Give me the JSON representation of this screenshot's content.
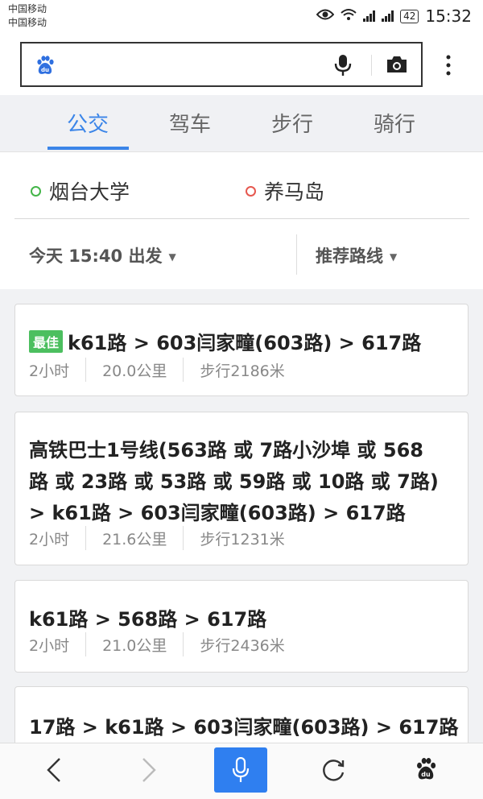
{
  "status_bar": {
    "carrier_1": "中国移动",
    "carrier_2": "中国移动",
    "battery": "42",
    "time": "15:32",
    "network_1": "2G",
    "network_2": "2G"
  },
  "search": {
    "placeholder": "",
    "logo_icon": "baidu-paw-icon"
  },
  "tabs": [
    {
      "label": "公交",
      "active": true
    },
    {
      "label": "驾车",
      "active": false
    },
    {
      "label": "步行",
      "active": false
    },
    {
      "label": "骑行",
      "active": false
    }
  ],
  "route": {
    "from": "烟台大学",
    "to": "养马岛",
    "time_option": "今天 15:40 出发",
    "preference": "推荐路线"
  },
  "results": [
    {
      "badge": "最佳",
      "lines": [
        "k61路 > 603闫家疃(603路)  > 617路"
      ],
      "duration": "2小时",
      "distance": "20.0公里",
      "walk": "步行2186米"
    },
    {
      "badge": "",
      "lines": [
        "高铁巴士1号线(563路 或 7路小沙埠 或 568",
        "路 或 23路 或 53路 或 59路 或 10路 或 7路)",
        "> k61路 > 603闫家疃(603路)  > 617路"
      ],
      "duration": "2小时",
      "distance": "21.6公里",
      "walk": "步行1231米"
    },
    {
      "badge": "",
      "lines": [
        "k61路 > 568路 > 617路"
      ],
      "duration": "2小时",
      "distance": "21.0公里",
      "walk": "步行2436米"
    },
    {
      "badge": "",
      "lines": [
        "17路 > k61路 > 603闫家疃(603路)  > 617路"
      ],
      "duration": "",
      "distance": "",
      "walk": ""
    }
  ],
  "colors": {
    "accent": "#3b85e8",
    "best_badge": "#4cbf5f",
    "start_dot": "#44b549",
    "end_dot": "#e6584f"
  }
}
